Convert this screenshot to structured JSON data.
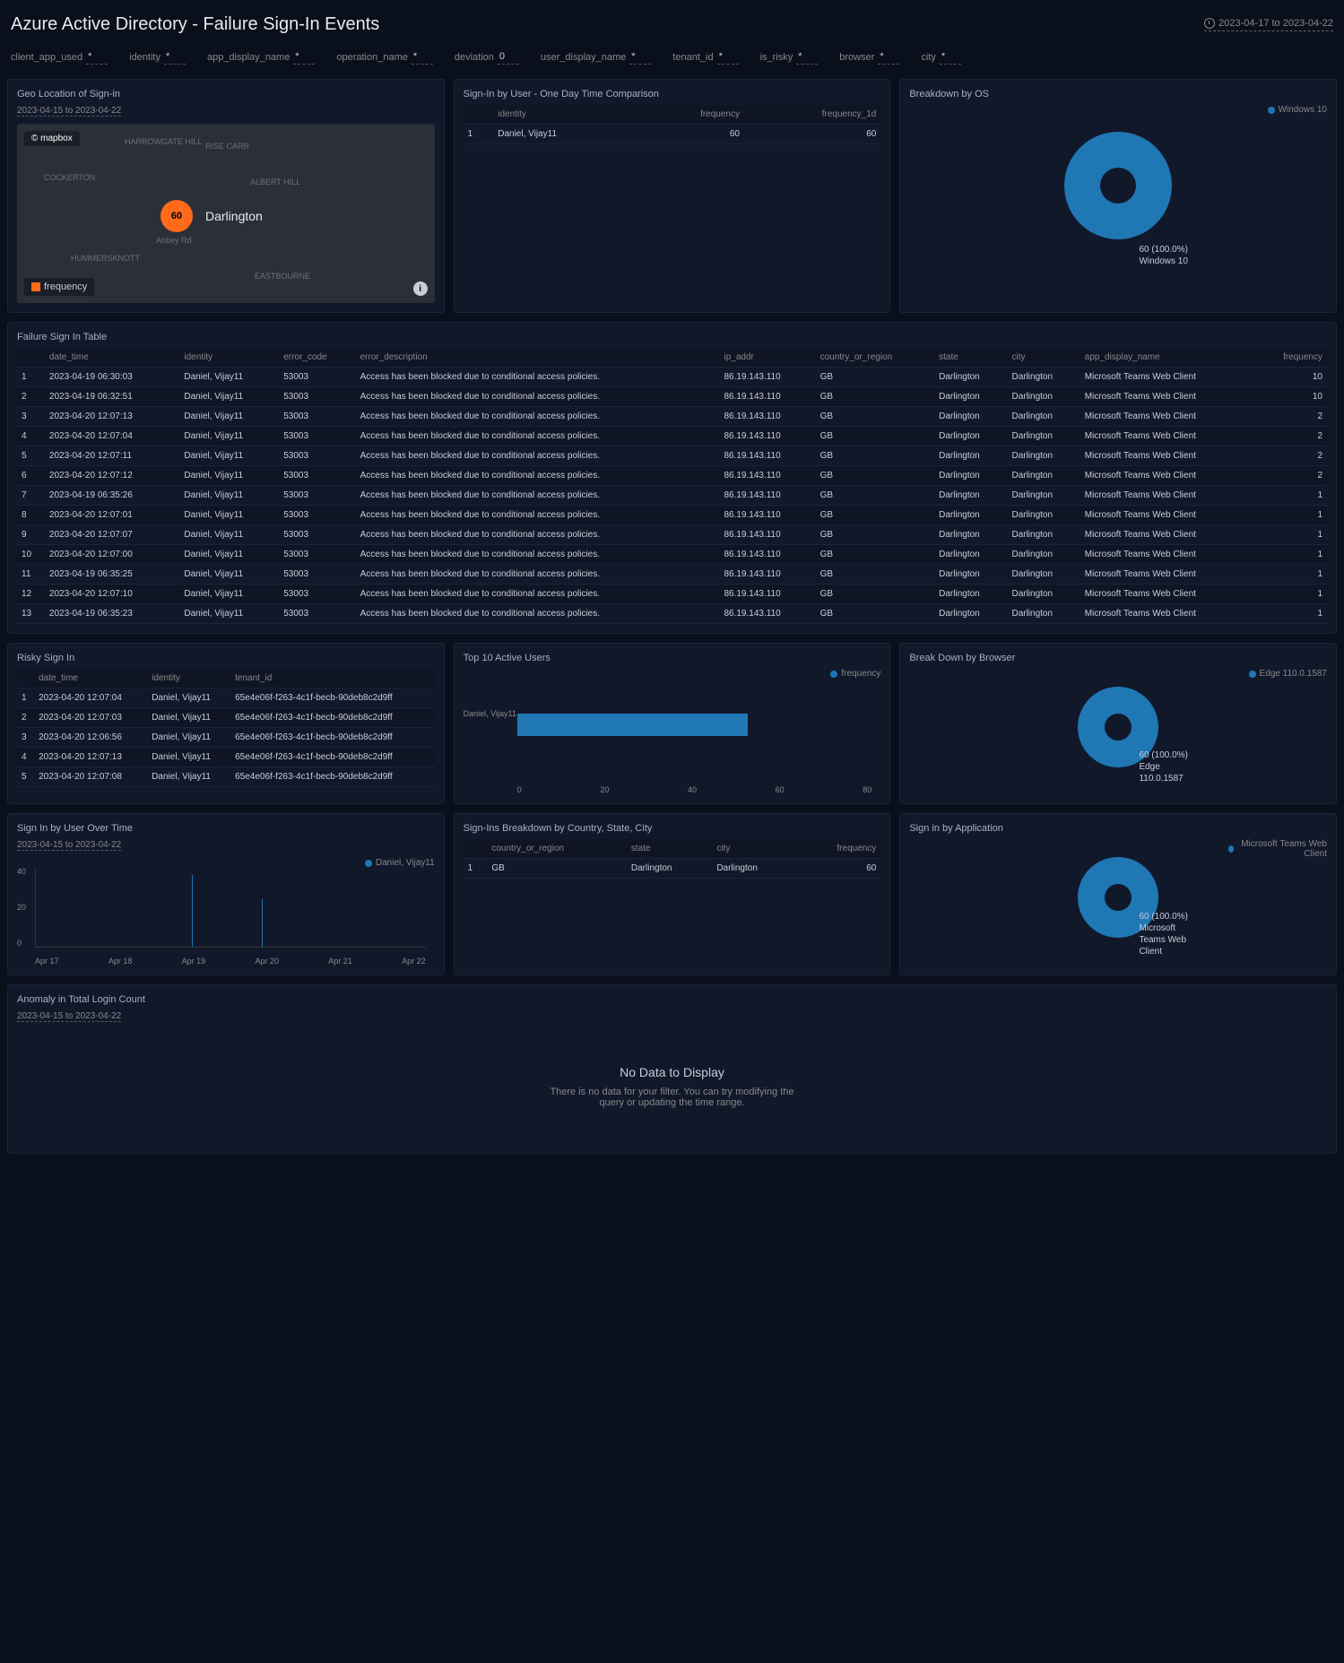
{
  "title": "Azure Active Directory - Failure Sign-In Events",
  "date_range": "2023-04-17 to 2023-04-22",
  "filters": [
    {
      "label": "client_app_used",
      "value": "*"
    },
    {
      "label": "identity",
      "value": "*"
    },
    {
      "label": "app_display_name",
      "value": "*"
    },
    {
      "label": "operation_name",
      "value": "*"
    },
    {
      "label": "deviation",
      "value": "0"
    },
    {
      "label": "user_display_name",
      "value": "*"
    },
    {
      "label": "tenant_id",
      "value": "*"
    },
    {
      "label": "is_risky",
      "value": "*"
    },
    {
      "label": "browser",
      "value": "*"
    },
    {
      "label": "city",
      "value": "*"
    }
  ],
  "geo": {
    "title": "Geo Location of Sign-in",
    "sub": "2023-04-15 to 2023-04-22",
    "logo": "© mapbox",
    "count": "60",
    "city": "Darlington",
    "legend": "frequency",
    "roads": [
      "HARROWGATE HILL",
      "RISE CARR",
      "COCKERTON",
      "ALBERT HILL",
      "HUMMERSKNOTT",
      "EASTBOURNE",
      "Abbey Rd"
    ]
  },
  "signin_user": {
    "title": "Sign-In by User - One Day Time Comparison",
    "headers": [
      "identity",
      "frequency",
      "frequency_1d"
    ],
    "rows": [
      [
        "1",
        "Daniel, Vijay11",
        "60",
        "60"
      ]
    ]
  },
  "os": {
    "title": "Breakdown by OS",
    "legend": "Windows 10",
    "label": "60 (100.0%)\nWindows 10"
  },
  "failure_table": {
    "title": "Failure Sign In Table",
    "headers": [
      "date_time",
      "identity",
      "error_code",
      "error_description",
      "ip_addr",
      "country_or_region",
      "state",
      "city",
      "app_display_name",
      "frequency"
    ],
    "rows": [
      [
        "1",
        "2023-04-19 06:30:03",
        "Daniel, Vijay11",
        "53003",
        "Access has been blocked due to conditional access policies.",
        "86.19.143.110",
        "GB",
        "Darlington",
        "Darlington",
        "Microsoft Teams Web Client",
        "10"
      ],
      [
        "2",
        "2023-04-19 06:32:51",
        "Daniel, Vijay11",
        "53003",
        "Access has been blocked due to conditional access policies.",
        "86.19.143.110",
        "GB",
        "Darlington",
        "Darlington",
        "Microsoft Teams Web Client",
        "10"
      ],
      [
        "3",
        "2023-04-20 12:07:13",
        "Daniel, Vijay11",
        "53003",
        "Access has been blocked due to conditional access policies.",
        "86.19.143.110",
        "GB",
        "Darlington",
        "Darlington",
        "Microsoft Teams Web Client",
        "2"
      ],
      [
        "4",
        "2023-04-20 12:07:04",
        "Daniel, Vijay11",
        "53003",
        "Access has been blocked due to conditional access policies.",
        "86.19.143.110",
        "GB",
        "Darlington",
        "Darlington",
        "Microsoft Teams Web Client",
        "2"
      ],
      [
        "5",
        "2023-04-20 12:07:11",
        "Daniel, Vijay11",
        "53003",
        "Access has been blocked due to conditional access policies.",
        "86.19.143.110",
        "GB",
        "Darlington",
        "Darlington",
        "Microsoft Teams Web Client",
        "2"
      ],
      [
        "6",
        "2023-04-20 12:07:12",
        "Daniel, Vijay11",
        "53003",
        "Access has been blocked due to conditional access policies.",
        "86.19.143.110",
        "GB",
        "Darlington",
        "Darlington",
        "Microsoft Teams Web Client",
        "2"
      ],
      [
        "7",
        "2023-04-19 06:35:26",
        "Daniel, Vijay11",
        "53003",
        "Access has been blocked due to conditional access policies.",
        "86.19.143.110",
        "GB",
        "Darlington",
        "Darlington",
        "Microsoft Teams Web Client",
        "1"
      ],
      [
        "8",
        "2023-04-20 12:07:01",
        "Daniel, Vijay11",
        "53003",
        "Access has been blocked due to conditional access policies.",
        "86.19.143.110",
        "GB",
        "Darlington",
        "Darlington",
        "Microsoft Teams Web Client",
        "1"
      ],
      [
        "9",
        "2023-04-20 12:07:07",
        "Daniel, Vijay11",
        "53003",
        "Access has been blocked due to conditional access policies.",
        "86.19.143.110",
        "GB",
        "Darlington",
        "Darlington",
        "Microsoft Teams Web Client",
        "1"
      ],
      [
        "10",
        "2023-04-20 12:07:00",
        "Daniel, Vijay11",
        "53003",
        "Access has been blocked due to conditional access policies.",
        "86.19.143.110",
        "GB",
        "Darlington",
        "Darlington",
        "Microsoft Teams Web Client",
        "1"
      ],
      [
        "11",
        "2023-04-19 06:35:25",
        "Daniel, Vijay11",
        "53003",
        "Access has been blocked due to conditional access policies.",
        "86.19.143.110",
        "GB",
        "Darlington",
        "Darlington",
        "Microsoft Teams Web Client",
        "1"
      ],
      [
        "12",
        "2023-04-20 12:07:10",
        "Daniel, Vijay11",
        "53003",
        "Access has been blocked due to conditional access policies.",
        "86.19.143.110",
        "GB",
        "Darlington",
        "Darlington",
        "Microsoft Teams Web Client",
        "1"
      ],
      [
        "13",
        "2023-04-19 06:35:23",
        "Daniel, Vijay11",
        "53003",
        "Access has been blocked due to conditional access policies.",
        "86.19.143.110",
        "GB",
        "Darlington",
        "Darlington",
        "Microsoft Teams Web Client",
        "1"
      ]
    ]
  },
  "risky": {
    "title": "Risky Sign In",
    "headers": [
      "date_time",
      "identity",
      "tenant_id"
    ],
    "rows": [
      [
        "1",
        "2023-04-20 12:07:04",
        "Daniel, Vijay11",
        "65e4e06f-f263-4c1f-becb-90deb8c2d9ff"
      ],
      [
        "2",
        "2023-04-20 12:07:03",
        "Daniel, Vijay11",
        "65e4e06f-f263-4c1f-becb-90deb8c2d9ff"
      ],
      [
        "3",
        "2023-04-20 12:06:56",
        "Daniel, Vijay11",
        "65e4e06f-f263-4c1f-becb-90deb8c2d9ff"
      ],
      [
        "4",
        "2023-04-20 12:07:13",
        "Daniel, Vijay11",
        "65e4e06f-f263-4c1f-becb-90deb8c2d9ff"
      ],
      [
        "5",
        "2023-04-20 12:07:08",
        "Daniel, Vijay11",
        "65e4e06f-f263-4c1f-becb-90deb8c2d9ff"
      ]
    ]
  },
  "top_users": {
    "title": "Top 10 Active Users",
    "legend": "frequency",
    "user": "Daniel, Vijay11",
    "xlabels": [
      "0",
      "20",
      "40",
      "60",
      "80"
    ]
  },
  "browser": {
    "title": "Break Down by Browser",
    "legend": "Edge 110.0.1587",
    "label": "60 (100.0%)\nEdge\n110.0.1587"
  },
  "user_time": {
    "title": "Sign In by User Over Time",
    "sub": "2023-04-15 to 2023-04-22",
    "legend": "Daniel, Vijay11",
    "ylabels": [
      "40",
      "20",
      "0"
    ],
    "xlabels": [
      "Apr 17",
      "Apr 18",
      "Apr 19",
      "Apr 20",
      "Apr 21",
      "Apr 22"
    ]
  },
  "country": {
    "title": "Sign-Ins Breakdown by Country, State, City",
    "headers": [
      "country_or_region",
      "state",
      "city",
      "frequency"
    ],
    "rows": [
      [
        "1",
        "GB",
        "Darlington",
        "Darlington",
        "60"
      ]
    ]
  },
  "app": {
    "title": "Sign in by Application",
    "legend": "Microsoft Teams Web Client",
    "label": "60 (100.0%)\nMicrosoft\nTeams Web\nClient"
  },
  "anomaly": {
    "title": "Anomaly in Total Login Count",
    "sub": "2023-04-15 to 2023-04-22",
    "no_data_title": "No Data to Display",
    "no_data_msg": "There is no data for your filter. You can try modifying the query or updating the time range."
  },
  "chart_data": [
    {
      "type": "pie",
      "title": "Breakdown by OS",
      "categories": [
        "Windows 10"
      ],
      "values": [
        60
      ]
    },
    {
      "type": "bar",
      "title": "Top 10 Active Users",
      "categories": [
        "Daniel, Vijay11"
      ],
      "values": [
        60
      ],
      "xlim": [
        0,
        80
      ],
      "orientation": "horizontal"
    },
    {
      "type": "pie",
      "title": "Break Down by Browser",
      "categories": [
        "Edge 110.0.1587"
      ],
      "values": [
        60
      ]
    },
    {
      "type": "line",
      "title": "Sign In by User Over Time",
      "series": [
        {
          "name": "Daniel, Vijay11",
          "x": [
            "Apr 19",
            "Apr 20"
          ],
          "y": [
            36,
            24
          ]
        }
      ],
      "ylim": [
        0,
        40
      ]
    },
    {
      "type": "pie",
      "title": "Sign in by Application",
      "categories": [
        "Microsoft Teams Web Client"
      ],
      "values": [
        60
      ]
    }
  ]
}
